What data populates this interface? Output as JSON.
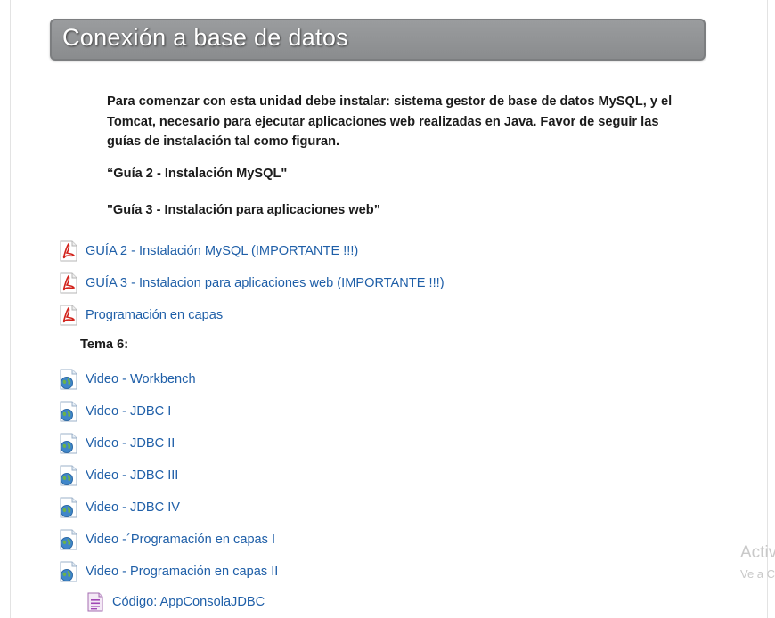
{
  "section": {
    "title": "Conexión a base de datos"
  },
  "intro": {
    "paragraph": "Para comenzar con esta unidad debe instalar: sistema gestor de base de datos MySQL, y el Tomcat, necesario para ejecutar aplicaciones web realizadas en Java. Favor de seguir las guías de instalación tal como figuran.",
    "guide2": "“Guía 2 - Instalación MySQL\"",
    "guide3": "\"Guía 3 - Instalación para aplicaciones web”"
  },
  "pdf_items": [
    {
      "label": "GUÍA 2 - Instalación MySQL (IMPORTANTE !!!)",
      "icon": "pdf-icon"
    },
    {
      "label": "GUÍA 3 - Instalacion para aplicaciones web (IMPORTANTE !!!)",
      "icon": "pdf-icon"
    },
    {
      "label": "Programación en capas",
      "icon": "pdf-icon"
    }
  ],
  "tema": {
    "label": "Tema 6:"
  },
  "video_items": [
    {
      "label": "Video - Workbench",
      "icon": "url-globe-icon"
    },
    {
      "label": "Video - JDBC I",
      "icon": "url-globe-icon"
    },
    {
      "label": "Video - JDBC II",
      "icon": "url-globe-icon"
    },
    {
      "label": "Video - JDBC III",
      "icon": "url-globe-icon"
    },
    {
      "label": "Video - JDBC IV",
      "icon": "url-globe-icon"
    },
    {
      "label": "Video -´Programación en capas I",
      "icon": "url-globe-icon"
    },
    {
      "label": "Video - Programación en capas II",
      "icon": "url-globe-icon"
    }
  ],
  "code_item": {
    "label": "Código: AppConsolaJDBC",
    "icon": "code-file-icon"
  },
  "watermark": {
    "line1": "Activ",
    "line2": "Ve a C"
  },
  "colors": {
    "link": "#1f5fa8",
    "banner": "#8f9193",
    "pdf_red": "#d2231c"
  }
}
